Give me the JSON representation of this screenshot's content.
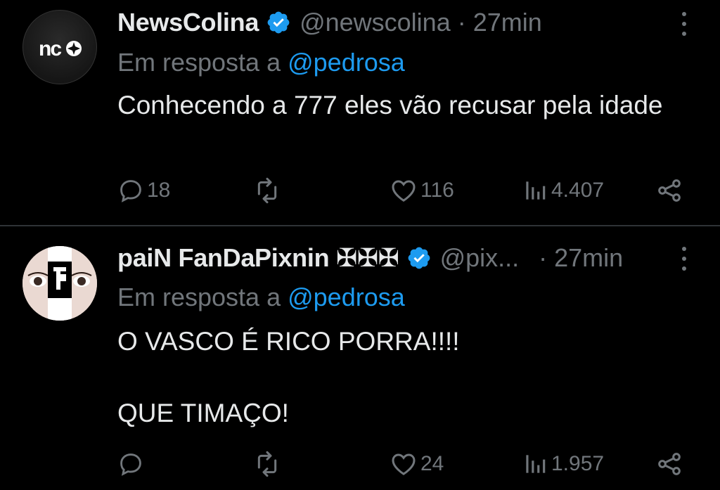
{
  "tweets": [
    {
      "name": "NewsColina",
      "handle": "@newscolina",
      "time": "· 27min",
      "reply_prefix": "Em resposta a ",
      "reply_to": "@pedrosa",
      "text": "Conhecendo a 777 eles vão recusar pela idade",
      "avatar_text": "nco",
      "metrics": {
        "replies": "18",
        "retweets": "",
        "likes": "116",
        "views": "4.407"
      }
    },
    {
      "name": "paiN FanDaPixnin ✠✠✠",
      "handle": "@pix...",
      "time": "· 27min",
      "reply_prefix": "Em resposta a ",
      "reply_to": "@pedrosa",
      "text": "O VASCO É RICO PORRA!!!!\n\nQUE TIMAÇO!",
      "metrics": {
        "replies": "",
        "retweets": "",
        "likes": "24",
        "views": "1.957"
      }
    }
  ],
  "colors": {
    "background": "#000000",
    "text": "#e7e9ea",
    "muted": "#71767b",
    "accent": "#1d9bf0",
    "verified": "#1d9bf0"
  },
  "icons": [
    "verified-badge-icon",
    "more-icon",
    "reply-icon",
    "retweet-icon",
    "like-icon",
    "views-icon",
    "share-icon"
  ]
}
